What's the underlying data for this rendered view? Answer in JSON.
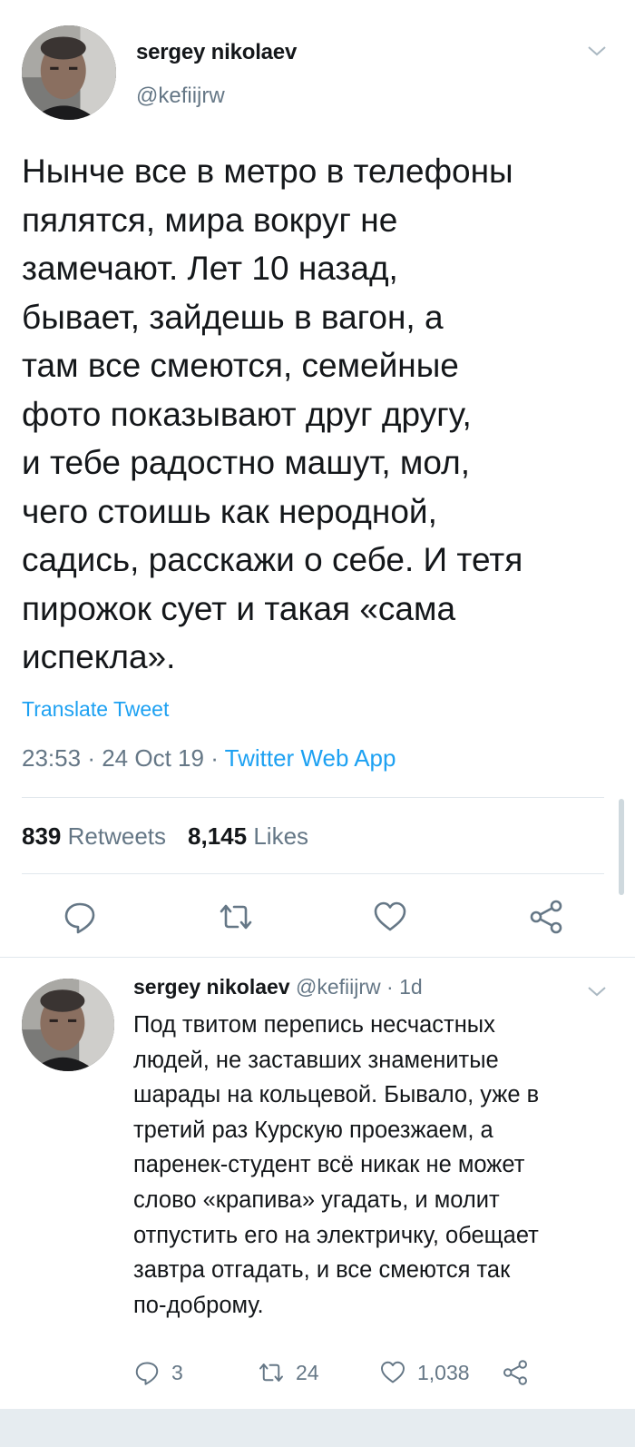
{
  "main_tweet": {
    "author_name": "sergey nikolaev",
    "author_handle": "@kefiijrw",
    "text_lines": [
      "Нынче все в метро в телефоны",
      "пялятся, мира вокруг не",
      "замечают. Лет 10 назад,",
      "бывает, зайдешь в вагон, а",
      "там все смеются, семейные",
      "фото показывают друг другу,",
      "и тебе радостно машут, мол,",
      "чего стоишь как неродной,",
      "садись, расскажи о себе. И тетя",
      "пирожок сует и такая «сама",
      "испекла»."
    ],
    "translate_label": "Translate Tweet",
    "time": "23:53",
    "date": "24 Oct 19",
    "separator": "·",
    "source": "Twitter Web App",
    "retweets_count": "839",
    "retweets_label": "Retweets",
    "likes_count": "8,145",
    "likes_label": "Likes"
  },
  "reply_tweet": {
    "author_name": "sergey nikolaev",
    "author_handle": "@kefiijrw",
    "age": "· 1d",
    "text_lines": [
      "Под твитом перепись несчастных",
      "людей, не заставших знаменитые",
      "шарады на кольцевой. Бывало, уже в",
      "третий раз Курскую проезжаем, а",
      "паренек-студент всё никак не может",
      "слово «крапива» угадать, и молит",
      "отпустить его на электричку, обещает",
      "завтра отгадать, и все смеются так",
      "по-доброму."
    ],
    "replies_count": "3",
    "retweets_count": "24",
    "likes_count": "1,038"
  },
  "colors": {
    "text": "#14171a",
    "secondary": "#657786",
    "link": "#1da1f2",
    "divider": "#e1e8ed",
    "icon": "#657786"
  },
  "icons": [
    "reply-icon",
    "retweet-icon",
    "like-icon",
    "share-icon",
    "chevron-down-icon"
  ]
}
